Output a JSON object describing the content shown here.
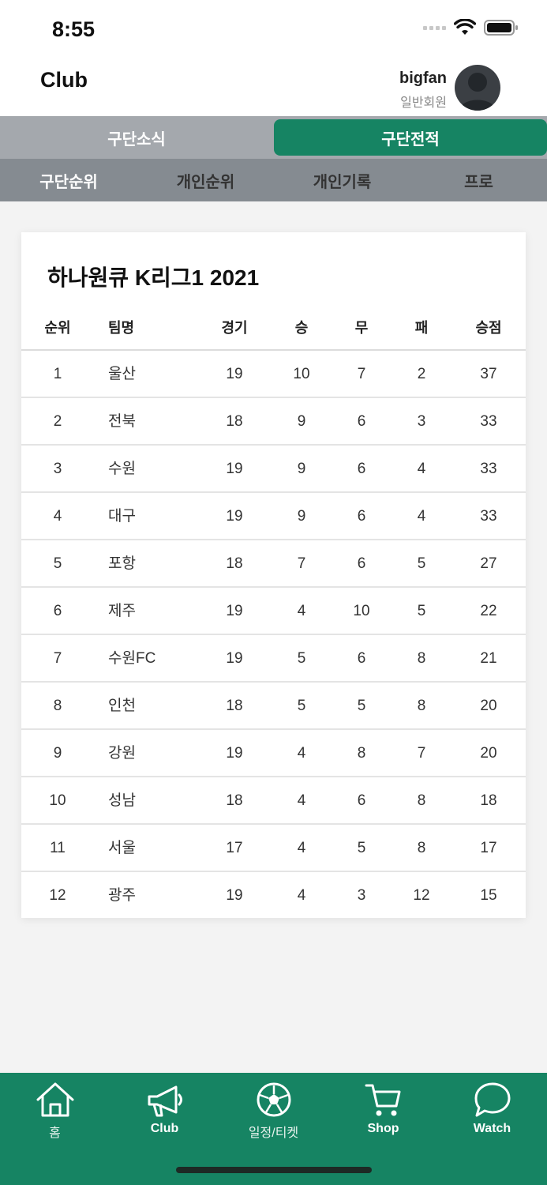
{
  "status_bar": {
    "time": "8:55"
  },
  "header": {
    "title": "Club",
    "user_name": "bigfan",
    "user_role": "일반회원"
  },
  "tabs": [
    {
      "label": "구단소식",
      "active": false
    },
    {
      "label": "구단전적",
      "active": true
    }
  ],
  "subtabs": [
    {
      "label": "구단순위",
      "active": true
    },
    {
      "label": "개인순위",
      "active": false
    },
    {
      "label": "개인기록",
      "active": false
    },
    {
      "label": "프로",
      "active": false
    }
  ],
  "standings": {
    "title": "하나원큐 K리그1 2021",
    "columns": [
      "순위",
      "팀명",
      "경기",
      "승",
      "무",
      "패",
      "승점"
    ],
    "rows": [
      [
        "1",
        "울산",
        "19",
        "10",
        "7",
        "2",
        "37"
      ],
      [
        "2",
        "전북",
        "18",
        "9",
        "6",
        "3",
        "33"
      ],
      [
        "3",
        "수원",
        "19",
        "9",
        "6",
        "4",
        "33"
      ],
      [
        "4",
        "대구",
        "19",
        "9",
        "6",
        "4",
        "33"
      ],
      [
        "5",
        "포항",
        "18",
        "7",
        "6",
        "5",
        "27"
      ],
      [
        "6",
        "제주",
        "19",
        "4",
        "10",
        "5",
        "22"
      ],
      [
        "7",
        "수원FC",
        "19",
        "5",
        "6",
        "8",
        "21"
      ],
      [
        "8",
        "인천",
        "18",
        "5",
        "5",
        "8",
        "20"
      ],
      [
        "9",
        "강원",
        "19",
        "4",
        "8",
        "7",
        "20"
      ],
      [
        "10",
        "성남",
        "18",
        "4",
        "6",
        "8",
        "18"
      ],
      [
        "11",
        "서울",
        "17",
        "4",
        "5",
        "8",
        "17"
      ],
      [
        "12",
        "광주",
        "19",
        "4",
        "3",
        "12",
        "15"
      ]
    ]
  },
  "bottom_nav": [
    {
      "label": "홈",
      "icon": "home-icon"
    },
    {
      "label": "Club",
      "icon": "megaphone-icon"
    },
    {
      "label": "일정/티켓",
      "icon": "soccer-ball-icon"
    },
    {
      "label": "Shop",
      "icon": "cart-icon"
    },
    {
      "label": "Watch",
      "icon": "chat-bubble-icon"
    }
  ],
  "colors": {
    "accent": "#168463",
    "tab_bg": "#a4a8ad",
    "subtab_bg": "#858b91"
  }
}
